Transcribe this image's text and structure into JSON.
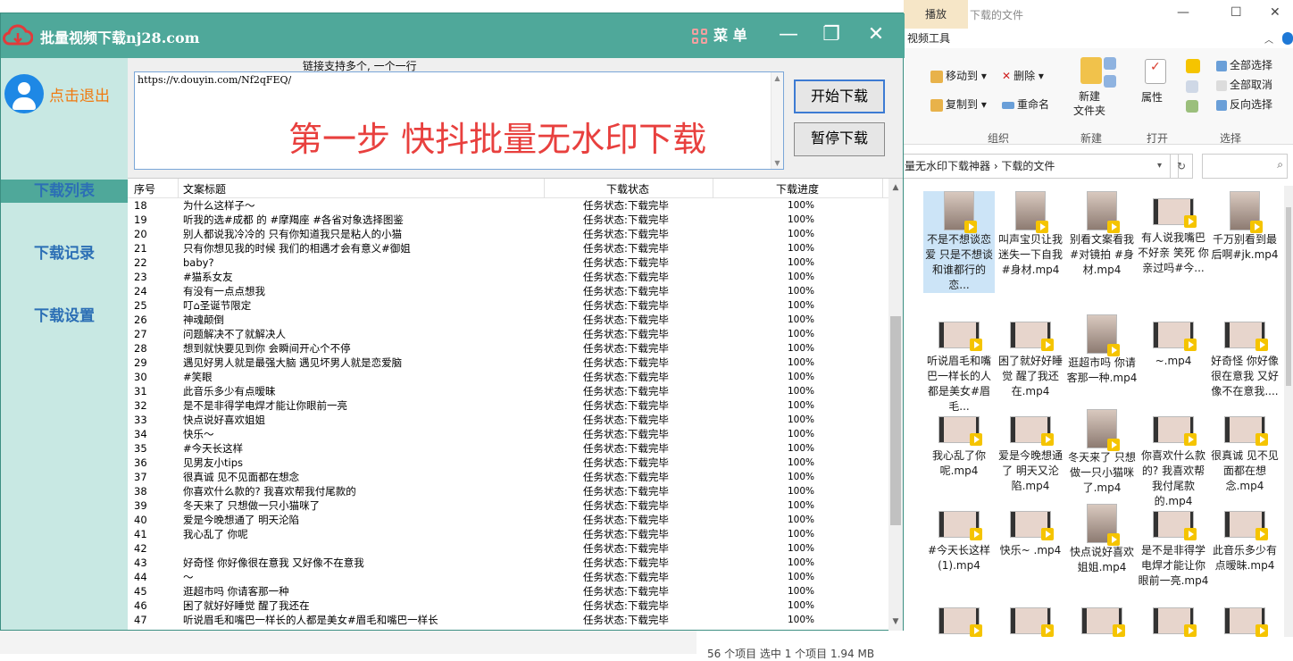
{
  "app": {
    "title": "批量视频下载nj28.com",
    "menu_label": "菜 单",
    "logout_label": "点击退出",
    "nav": [
      "下载列表",
      "下载记录",
      "下载设置"
    ],
    "hint": "链接支持多个, 一个一行",
    "url_value": "https://v.douyin.com/Nf2qFEQ/",
    "overlay_text": "第一步 快抖批量无水印下载",
    "start_button": "开始下载",
    "pause_button": "暂停下载",
    "columns": [
      "序号",
      "文案标题",
      "下载状态",
      "下载进度"
    ],
    "rows": [
      {
        "no": "18",
        "title": "为什么这样子～",
        "status": "任务状态:下载完毕",
        "progress": "100%"
      },
      {
        "no": "19",
        "title": "听我的选#成都 的 #摩羯座 #各省对象选择图鉴",
        "status": "任务状态:下载完毕",
        "progress": "100%"
      },
      {
        "no": "20",
        "title": "别人都说我冷冷的 只有你知道我只是粘人的小猫",
        "status": "任务状态:下载完毕",
        "progress": "100%"
      },
      {
        "no": "21",
        "title": "只有你想见我的时候 我们的相遇才会有意义#御姐",
        "status": "任务状态:下载完毕",
        "progress": "100%"
      },
      {
        "no": "22",
        "title": "baby?",
        "status": "任务状态:下载完毕",
        "progress": "100%"
      },
      {
        "no": "23",
        "title": "#猫系女友",
        "status": "任务状态:下载完毕",
        "progress": "100%"
      },
      {
        "no": "24",
        "title": "有没有一点点想我",
        "status": "任务状态:下载完毕",
        "progress": "100%"
      },
      {
        "no": "25",
        "title": "叮⌂圣诞节限定",
        "status": "任务状态:下载完毕",
        "progress": "100%"
      },
      {
        "no": "26",
        "title": "神魂颠倒",
        "status": "任务状态:下载完毕",
        "progress": "100%"
      },
      {
        "no": "27",
        "title": "问题解决不了就解决人",
        "status": "任务状态:下载完毕",
        "progress": "100%"
      },
      {
        "no": "28",
        "title": "想到就快要见到你 会瞬间开心个不停",
        "status": "任务状态:下载完毕",
        "progress": "100%"
      },
      {
        "no": "29",
        "title": "遇见好男人就是最强大脑 遇见坏男人就是恋爱脑",
        "status": "任务状态:下载完毕",
        "progress": "100%"
      },
      {
        "no": "30",
        "title": "#笑眼",
        "status": "任务状态:下载完毕",
        "progress": "100%"
      },
      {
        "no": "31",
        "title": "此音乐多少有点暧昧",
        "status": "任务状态:下载完毕",
        "progress": "100%"
      },
      {
        "no": "32",
        "title": "是不是非得学电焊才能让你眼前一亮",
        "status": "任务状态:下载完毕",
        "progress": "100%"
      },
      {
        "no": "33",
        "title": "快点说好喜欢姐姐",
        "status": "任务状态:下载完毕",
        "progress": "100%"
      },
      {
        "no": "34",
        "title": "快乐～",
        "status": "任务状态:下载完毕",
        "progress": "100%"
      },
      {
        "no": "35",
        "title": "#今天长这样",
        "status": "任务状态:下载完毕",
        "progress": "100%"
      },
      {
        "no": "36",
        "title": "见男友小tips",
        "status": "任务状态:下载完毕",
        "progress": "100%"
      },
      {
        "no": "37",
        "title": "很真诚 见不见面都在想念",
        "status": "任务状态:下载完毕",
        "progress": "100%"
      },
      {
        "no": "38",
        "title": "你喜欢什么款的? 我喜欢帮我付尾款的",
        "status": "任务状态:下载完毕",
        "progress": "100%"
      },
      {
        "no": "39",
        "title": "冬天来了 只想做一只小猫咪了",
        "status": "任务状态:下载完毕",
        "progress": "100%"
      },
      {
        "no": "40",
        "title": "爱是今晚想通了 明天沦陷",
        "status": "任务状态:下载完毕",
        "progress": "100%"
      },
      {
        "no": "41",
        "title": "我心乱了 你呢",
        "status": "任务状态:下载完毕",
        "progress": "100%"
      },
      {
        "no": "42",
        "title": "",
        "status": "任务状态:下载完毕",
        "progress": "100%"
      },
      {
        "no": "43",
        "title": "好奇怪 你好像很在意我 又好像不在意我",
        "status": "任务状态:下载完毕",
        "progress": "100%"
      },
      {
        "no": "44",
        "title": "～",
        "status": "任务状态:下载完毕",
        "progress": "100%"
      },
      {
        "no": "45",
        "title": "逛超市吗 你请客那一种",
        "status": "任务状态:下载完毕",
        "progress": "100%"
      },
      {
        "no": "46",
        "title": "困了就好好睡觉 醒了我还在",
        "status": "任务状态:下载完毕",
        "progress": "100%"
      },
      {
        "no": "47",
        "title": "听说眉毛和嘴巴一样长的人都是美女#眉毛和嘴巴一样长",
        "status": "任务状态:下载完毕",
        "progress": "100%"
      }
    ]
  },
  "explorer": {
    "play_tab": "播放",
    "window_title": "下载的文件",
    "video_tools": "视频工具",
    "ribbon": {
      "move_to": "移动到",
      "copy_to": "复制到",
      "delete": "删除",
      "rename": "重命名",
      "new_folder": "新建\n文件夹",
      "properties": "属性",
      "select_all": "全部选择",
      "select_none": "全部取消",
      "invert": "反向选择",
      "groups": [
        "组织",
        "新建",
        "打开",
        "选择"
      ]
    },
    "address": "量无水印下载神器 › 下载的文件",
    "files": [
      "不是不想谈恋爱 只是不想谈和谁都行的恋...",
      "叫声宝贝让我迷失一下自我 #身材.mp4",
      "别看文案看我#对镜拍 #身材.mp4",
      "有人说我嘴巴不好亲 笑死 你亲过吗#今...",
      "千万别看到最后啊#jk.mp4",
      "听说眉毛和嘴巴一样长的人都是美女#眉毛...",
      "困了就好好睡觉 醒了我还在.mp4",
      "逛超市吗 你请客那一种.mp4",
      "~.mp4",
      "好奇怪 你好像很在意我 又好像不在意我....",
      "我心乱了你呢.mp4",
      "爱是今晚想通了 明天又沦陷.mp4",
      "冬天来了 只想做一只小猫咪了.mp4",
      "你喜欢什么款的? 我喜欢帮我付尾款的.mp4",
      "很真诚 见不见面都在想念.mp4",
      "#今天长这样(1).mp4",
      "快乐~ .mp4",
      "快点说好喜欢姐姐.mp4",
      "是不是非得学电焊才能让你眼前一亮.mp4",
      "此音乐多少有点暧昧.mp4"
    ],
    "status": "56 个项目    选中 1 个项目  1.94 MB"
  }
}
